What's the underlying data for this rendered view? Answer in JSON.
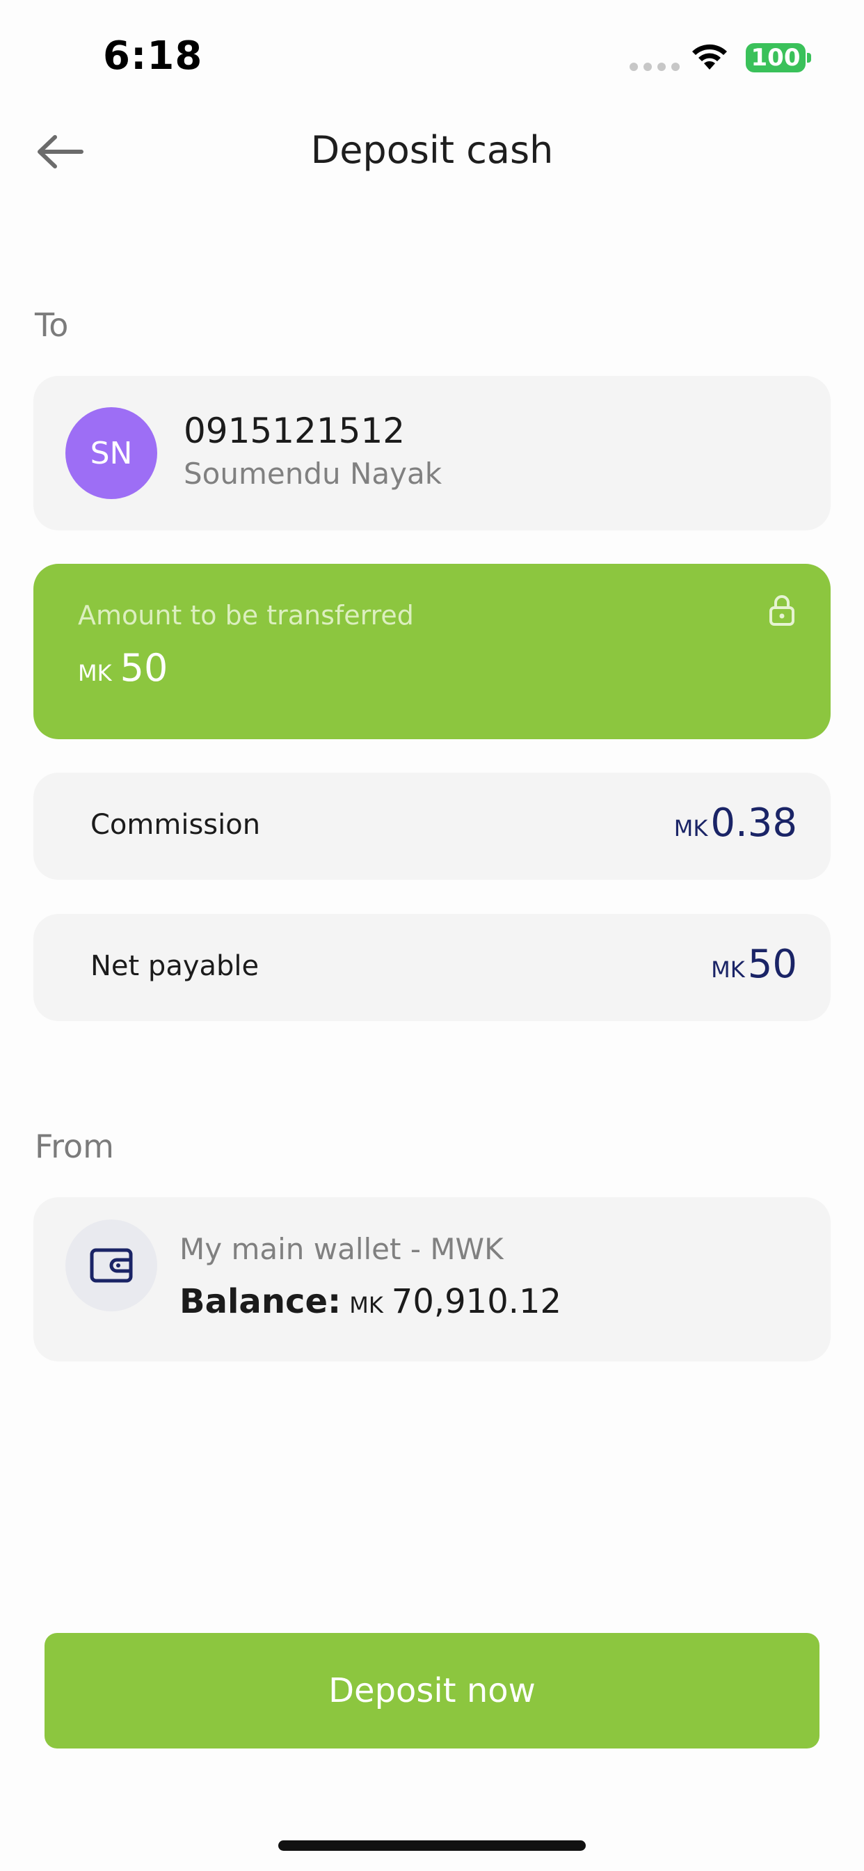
{
  "status_bar": {
    "time": "6:18",
    "battery": "100",
    "icons": [
      "cellular-signal-icon",
      "wifi-icon",
      "battery-icon"
    ]
  },
  "header": {
    "title": "Deposit cash",
    "back_icon": "arrow-left-icon"
  },
  "to_section": {
    "label": "To",
    "recipient": {
      "initials": "SN",
      "phone": "0915121512",
      "name": "Soumendu Nayak",
      "avatar_color": "#9d6ef5"
    }
  },
  "amount": {
    "label": "Amount to be transferred",
    "currency": "MK",
    "value": "50",
    "icon": "lock-icon",
    "background": "#8cc63f"
  },
  "summary": {
    "commission": {
      "label": "Commission",
      "currency": "MK",
      "value": "0.38"
    },
    "net_payable": {
      "label": "Net payable",
      "currency": "MK",
      "value": "50"
    },
    "value_color": "#1a2466"
  },
  "from_section": {
    "label": "From",
    "wallet": {
      "icon": "wallet-icon",
      "name": "My main wallet - MWK",
      "balance_label": "Balance:",
      "currency": "MK",
      "balance": "70,910.12"
    }
  },
  "cta": {
    "label": "Deposit now",
    "color": "#8cc63f"
  }
}
